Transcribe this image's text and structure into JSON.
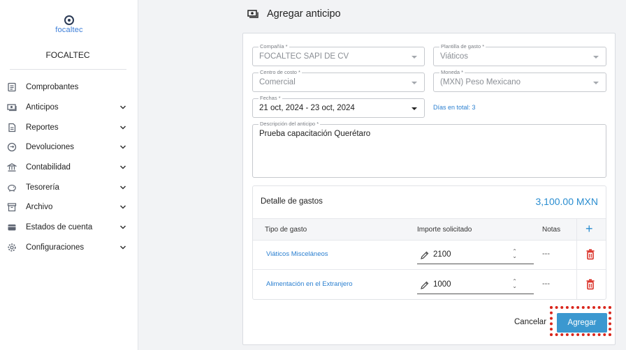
{
  "app": {
    "logo_text": "focaltec",
    "company": "FOCALTEC"
  },
  "sidebar": {
    "items": [
      {
        "label": "Comprobantes",
        "icon": "receipt-icon",
        "has_children": false
      },
      {
        "label": "Anticipos",
        "icon": "cash-icon",
        "has_children": true
      },
      {
        "label": "Reportes",
        "icon": "report-icon",
        "has_children": true
      },
      {
        "label": "Devoluciones",
        "icon": "refund-icon",
        "has_children": true
      },
      {
        "label": "Contabilidad",
        "icon": "bank-icon",
        "has_children": true
      },
      {
        "label": "Tesorería",
        "icon": "piggy-bank-icon",
        "has_children": true
      },
      {
        "label": "Archivo",
        "icon": "archive-icon",
        "has_children": true
      },
      {
        "label": "Estados de cuenta",
        "icon": "wallet-icon",
        "has_children": true
      },
      {
        "label": "Configuraciones",
        "icon": "gear-icon",
        "has_children": true
      }
    ]
  },
  "page": {
    "title": "Agregar anticipo",
    "title_icon": "cash-icon"
  },
  "form": {
    "company": {
      "label": "Compañía *",
      "value": "FOCALTEC SAPI DE CV"
    },
    "template": {
      "label": "Plantilla de gasto *",
      "value": "Viáticos"
    },
    "cost_center": {
      "label": "Centro de costo *",
      "value": "Comercial"
    },
    "currency": {
      "label": "Moneda *",
      "value": "(MXN) Peso Mexicano"
    },
    "dates": {
      "label": "Fechas *",
      "value": "21 oct, 2024 - 23 oct, 2024"
    },
    "days_total": "Días en total: 3",
    "description": {
      "label": "Descripción del anticipo *",
      "value": "Prueba capacitación Querétaro"
    }
  },
  "expenses": {
    "title": "Detalle de gastos",
    "total": "3,100.00 MXN",
    "headers": {
      "type": "Tipo de gasto",
      "amount": "Importe solicitado",
      "notes": "Notas",
      "add": "+"
    },
    "rows": [
      {
        "type": "Viáticos Misceláneos",
        "amount": "2100",
        "notes": "---"
      },
      {
        "type": "Alimentación en el Extranjero",
        "amount": "1000",
        "notes": "---"
      }
    ]
  },
  "actions": {
    "cancel": "Cancelar",
    "submit": "Agregar"
  },
  "colors": {
    "accent": "#3b98d0",
    "link": "#2a7fd0",
    "danger": "#d9261c",
    "highlight": "#d9261c"
  }
}
